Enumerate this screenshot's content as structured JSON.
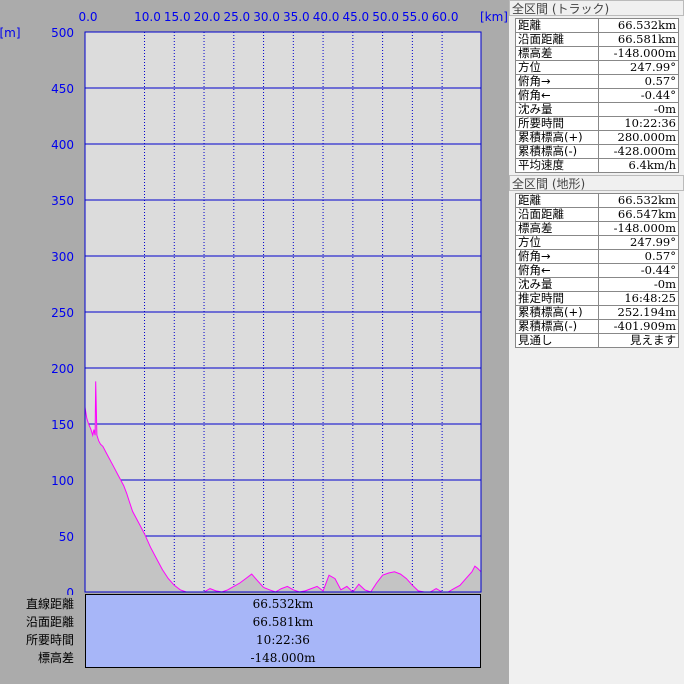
{
  "chart_data": {
    "type": "area",
    "x_unit": "[km]",
    "y_unit": "[m]",
    "x_ticks": [
      "0.0",
      "10.0",
      "15.0",
      "20.0",
      "25.0",
      "30.0",
      "35.0",
      "40.0",
      "45.0",
      "50.0",
      "55.0",
      "60.0"
    ],
    "x_tick_values": [
      0,
      10,
      15,
      20,
      25,
      30,
      35,
      40,
      45,
      50,
      55,
      60
    ],
    "y_ticks": [
      "500",
      "450",
      "400",
      "350",
      "300",
      "250",
      "200",
      "150",
      "100",
      "50",
      "0"
    ],
    "y_tick_values": [
      500,
      450,
      400,
      350,
      300,
      250,
      200,
      150,
      100,
      50,
      0
    ],
    "xlim": [
      0,
      66.532
    ],
    "ylim": [
      0,
      500
    ],
    "grid": true,
    "line_color": "#ff00ff",
    "fill_color": "#c4c4c4",
    "plot_bg": "#dcdcdc",
    "series": [
      {
        "x": [
          0,
          0.3,
          0.6,
          1.0,
          1.3,
          1.5,
          1.7,
          1.8,
          2.0,
          2.3,
          2.6,
          3.0,
          3.5,
          4.0,
          4.5,
          5.0,
          5.5,
          6.0,
          6.5,
          7.0,
          7.5,
          8.0,
          9.0,
          10.0,
          11.0,
          12.0,
          13.0,
          14.0,
          15.0,
          16.0,
          17.0,
          18.0,
          19.0,
          20.0,
          21.0,
          22.0,
          23.0,
          24.0,
          25.0,
          26.0,
          27.0,
          28.0,
          29.0,
          30.0,
          31.0,
          32.0,
          33.0,
          34.0,
          35.0,
          36.0,
          37.0,
          38.0,
          39.0,
          40.0,
          41.0,
          42.0,
          43.0,
          44.0,
          45.0,
          46.0,
          47.0,
          48.0,
          49.0,
          50.0,
          51.0,
          52.0,
          53.0,
          54.0,
          55.0,
          56.0,
          57.0,
          58.0,
          59.0,
          60.0,
          61.0,
          62.0,
          63.0,
          64.0,
          65.0,
          65.5,
          66.0,
          66.532
        ],
        "y": [
          165,
          155,
          150,
          145,
          140,
          145,
          140,
          188,
          140,
          135,
          132,
          130,
          125,
          120,
          115,
          110,
          105,
          100,
          95,
          88,
          80,
          72,
          62,
          52,
          40,
          30,
          20,
          12,
          6,
          2,
          0,
          0,
          0,
          0,
          3,
          1,
          0,
          2,
          5,
          8,
          12,
          16,
          10,
          4,
          2,
          0,
          3,
          5,
          2,
          0,
          1,
          3,
          5,
          1,
          15,
          12,
          2,
          5,
          0,
          7,
          2,
          0,
          8,
          15,
          17,
          18,
          16,
          12,
          6,
          1,
          0,
          0,
          3,
          0,
          0,
          3,
          6,
          12,
          18,
          23,
          21,
          18
        ]
      }
    ]
  },
  "summary": {
    "labels": [
      "直線距離",
      "沿面距離",
      "所要時間",
      "標高差"
    ],
    "values": [
      "66.532km",
      "66.581km",
      "10:22:36",
      "-148.000m"
    ]
  },
  "track_panel": {
    "title": "全区間 (トラック)",
    "rows": [
      {
        "label": "距離",
        "value": "66.532km"
      },
      {
        "label": "沿面距離",
        "value": "66.581km"
      },
      {
        "label": "標高差",
        "value": "-148.000m"
      },
      {
        "label": "方位",
        "value": "247.99°"
      },
      {
        "label": "俯角→",
        "value": "0.57°"
      },
      {
        "label": "俯角←",
        "value": "-0.44°"
      },
      {
        "label": "沈み量",
        "value": "-0m"
      },
      {
        "label": "所要時間",
        "value": "10:22:36"
      },
      {
        "label": "累積標高(+)",
        "value": "280.000m"
      },
      {
        "label": "累積標高(-)",
        "value": "-428.000m"
      },
      {
        "label": "平均速度",
        "value": "6.4km/h"
      }
    ]
  },
  "terrain_panel": {
    "title": "全区間 (地形)",
    "rows": [
      {
        "label": "距離",
        "value": "66.532km"
      },
      {
        "label": "沿面距離",
        "value": "66.547km"
      },
      {
        "label": "標高差",
        "value": "-148.000m"
      },
      {
        "label": "方位",
        "value": "247.99°"
      },
      {
        "label": "俯角→",
        "value": "0.57°"
      },
      {
        "label": "俯角←",
        "value": "-0.44°"
      },
      {
        "label": "沈み量",
        "value": "-0m"
      },
      {
        "label": "推定時間",
        "value": "16:48:25"
      },
      {
        "label": "累積標高(+)",
        "value": "252.194m"
      },
      {
        "label": "累積標高(-)",
        "value": "-401.909m"
      },
      {
        "label": "見通し",
        "value": "見えます"
      }
    ]
  }
}
